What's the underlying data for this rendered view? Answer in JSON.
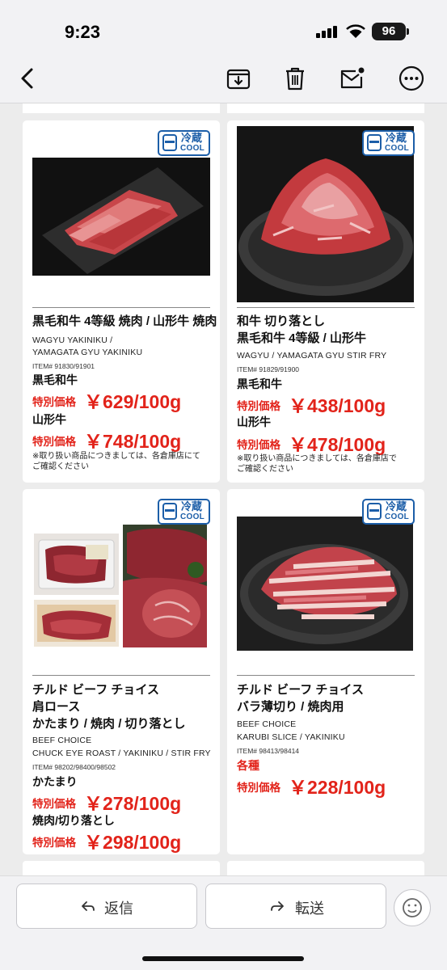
{
  "status_bar": {
    "time": "9:23",
    "battery": "96"
  },
  "toolbar": {
    "back": "back-icon",
    "archive": "archive-icon",
    "trash": "trash-icon",
    "mail": "mail-icon",
    "more": "more-icon"
  },
  "badge": {
    "jp": "冷蔵",
    "en": "COOL"
  },
  "products": [
    {
      "title_lines": [
        "黒毛和牛 4等級 焼肉 / 山形牛 焼肉"
      ],
      "en_lines": [
        "WAGYU YAKINIKU /",
        "YAMAGATA GYU YAKINIKU"
      ],
      "item_no": "ITEM# 91830/91901",
      "prices": [
        {
          "variety": "黒毛和牛",
          "label": "特別価格",
          "amount": "￥629/100g"
        },
        {
          "variety": "山形牛",
          "label": "特別価格",
          "amount": "￥748/100g"
        }
      ],
      "note_lines": [
        "※取り扱い商品につきましては、各倉庫店にて",
        "ご確認ください"
      ]
    },
    {
      "title_lines": [
        "和牛 切り落とし",
        "黒毛和牛 4等級 / 山形牛"
      ],
      "en_lines": [
        "WAGYU / YAMAGATA GYU STIR FRY"
      ],
      "item_no": "ITEM# 91829/91900",
      "prices": [
        {
          "variety": "黒毛和牛",
          "label": "特別価格",
          "amount": "￥438/100g"
        },
        {
          "variety": "山形牛",
          "label": "特別価格",
          "amount": "￥478/100g"
        }
      ],
      "note_lines": [
        "※取り扱い商品につきましては、各倉庫店で",
        "ご確認ください"
      ]
    },
    {
      "title_lines": [
        "チルド ビーフ チョイス",
        "肩ロース",
        "かたまり / 焼肉 / 切り落とし"
      ],
      "en_lines": [
        "BEEF CHOICE",
        "CHUCK EYE ROAST / YAKINIKU / STIR FRY"
      ],
      "item_no": "ITEM# 98202/98400/98502",
      "prices": [
        {
          "variety": "かたまり",
          "label": "特別価格",
          "amount": "￥278/100g"
        },
        {
          "variety": "焼肉/切り落とし",
          "label": "特別価格",
          "amount": "￥298/100g"
        }
      ],
      "note_lines": []
    },
    {
      "title_lines": [
        "チルド ビーフ チョイス",
        "バラ薄切り / 焼肉用"
      ],
      "en_lines": [
        "BEEF CHOICE",
        "KARUBI SLICE / YAKINIKU"
      ],
      "item_no": "ITEM# 98413/98414",
      "prices": [
        {
          "variety": "各種",
          "label": "特別価格",
          "amount": "￥228/100g"
        }
      ],
      "note_lines": []
    }
  ],
  "bottom_bar": {
    "reply": "返信",
    "forward": "転送",
    "emoji": "emoji-icon"
  },
  "colors": {
    "price_red": "#e2231a",
    "cool_blue": "#1c5ea8"
  }
}
